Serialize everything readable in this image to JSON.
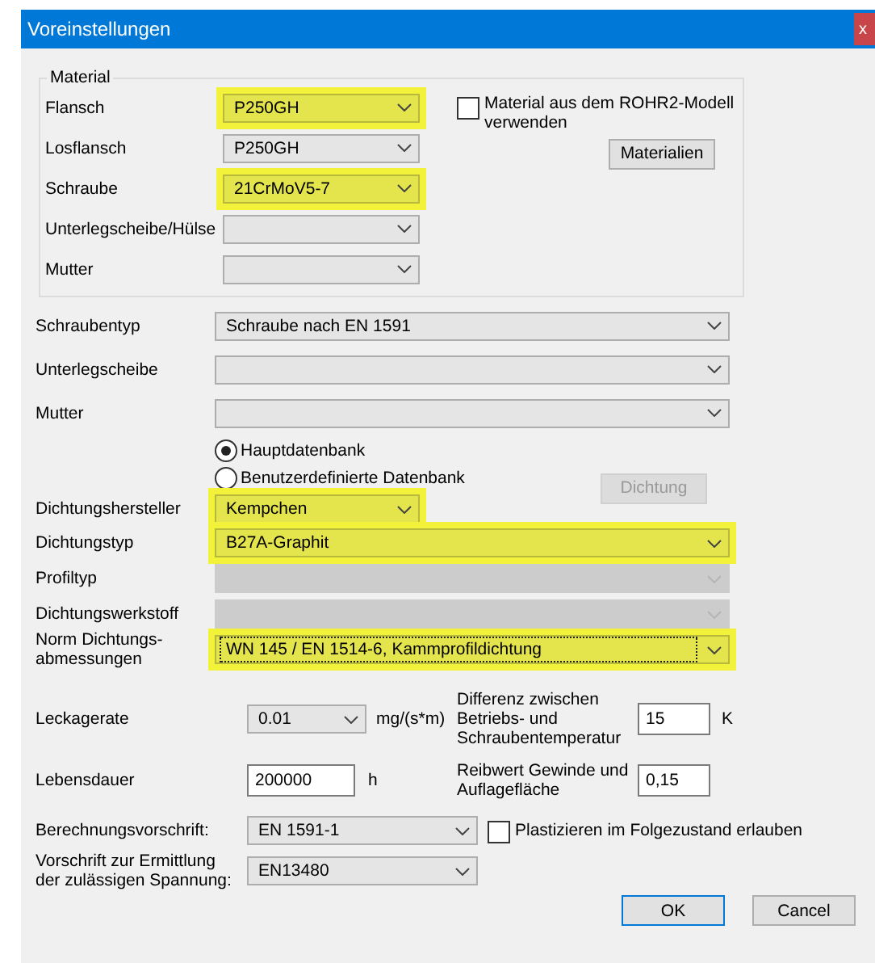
{
  "window": {
    "title": "Voreinstellungen",
    "close": "x"
  },
  "material": {
    "title": "Material",
    "rows": [
      {
        "label": "Flansch",
        "value": "P250GH",
        "highlighted": true,
        "disabled": false
      },
      {
        "label": "Losflansch",
        "value": "P250GH",
        "highlighted": false,
        "disabled": false
      },
      {
        "label": "Schraube",
        "value": "21CrMoV5-7",
        "highlighted": true,
        "disabled": false
      },
      {
        "label": "Unterlegscheibe/Hülse",
        "highlighted": false,
        "disabled": false
      },
      {
        "label": "Mutter",
        "highlighted": false,
        "disabled": false
      }
    ],
    "checkbox": {
      "label": "Material aus dem ROHR2-Modell verwenden",
      "checked": false
    },
    "button": {
      "label": "Materialien",
      "disabled": false
    }
  },
  "bolt_fields": [
    {
      "label": "Schraubentyp",
      "value": "Schraube nach EN 1591",
      "highlighted": false,
      "disabled": false
    },
    {
      "label": "Unterlegscheibe",
      "highlighted": false,
      "disabled": false
    },
    {
      "label": "Mutter",
      "highlighted": false,
      "disabled": false
    }
  ],
  "database_options": [
    {
      "label": "Hauptdatenbank",
      "selected": true
    },
    {
      "label": "Benutzerdefinierte Datenbank",
      "selected": false
    }
  ],
  "gasket_button": {
    "label": "Dichtung",
    "disabled": true
  },
  "gasket_fields": [
    {
      "label": "Dichtungshersteller",
      "value": "Kempchen",
      "highlighted": true,
      "disabled": false,
      "kind": "short",
      "focused": false
    },
    {
      "label": "Dichtungstyp",
      "value": "B27A-Graphit",
      "highlighted": true,
      "disabled": false,
      "kind": "wide",
      "focused": false
    },
    {
      "label": "Profiltyp",
      "highlighted": false,
      "disabled": true,
      "kind": "wide",
      "focused": false
    },
    {
      "label": "Dichtungswerkstoff",
      "highlighted": false,
      "disabled": true,
      "kind": "wide",
      "focused": false
    },
    {
      "label": "Norm Dichtungs-\nabmessungen",
      "value": "WN 145 / EN 1514-6, Kammprofildichtung",
      "highlighted": true,
      "disabled": false,
      "kind": "wide",
      "focused": true
    }
  ],
  "leakage_rate": {
    "label": "Leckagerate",
    "value": "0.01",
    "unit": "mg/(s*m)"
  },
  "temperature_difference": {
    "label": "Differenz zwischen\nBetriebs- und\nSchraubentemperatur",
    "value": "15",
    "unit": "K"
  },
  "lifetime": {
    "label": "Lebensdauer",
    "value": "200000",
    "unit": "h"
  },
  "friction": {
    "label": "Reibwert Gewinde und\nAuflagefläche",
    "value": "0,15"
  },
  "calculation_rule": {
    "label": "Berechnungsvorschrift:",
    "value": "EN 1591-1"
  },
  "plasticize": {
    "label": "Plastizieren im Folgezustand erlauben",
    "checked": false
  },
  "stress_rule": {
    "label": "Vorschrift zur Ermittlung\nder zulässigen Spannung:",
    "value": "EN13480"
  },
  "buttons": [
    {
      "label": "OK",
      "default": true
    },
    {
      "label": "Cancel",
      "default": false
    }
  ]
}
